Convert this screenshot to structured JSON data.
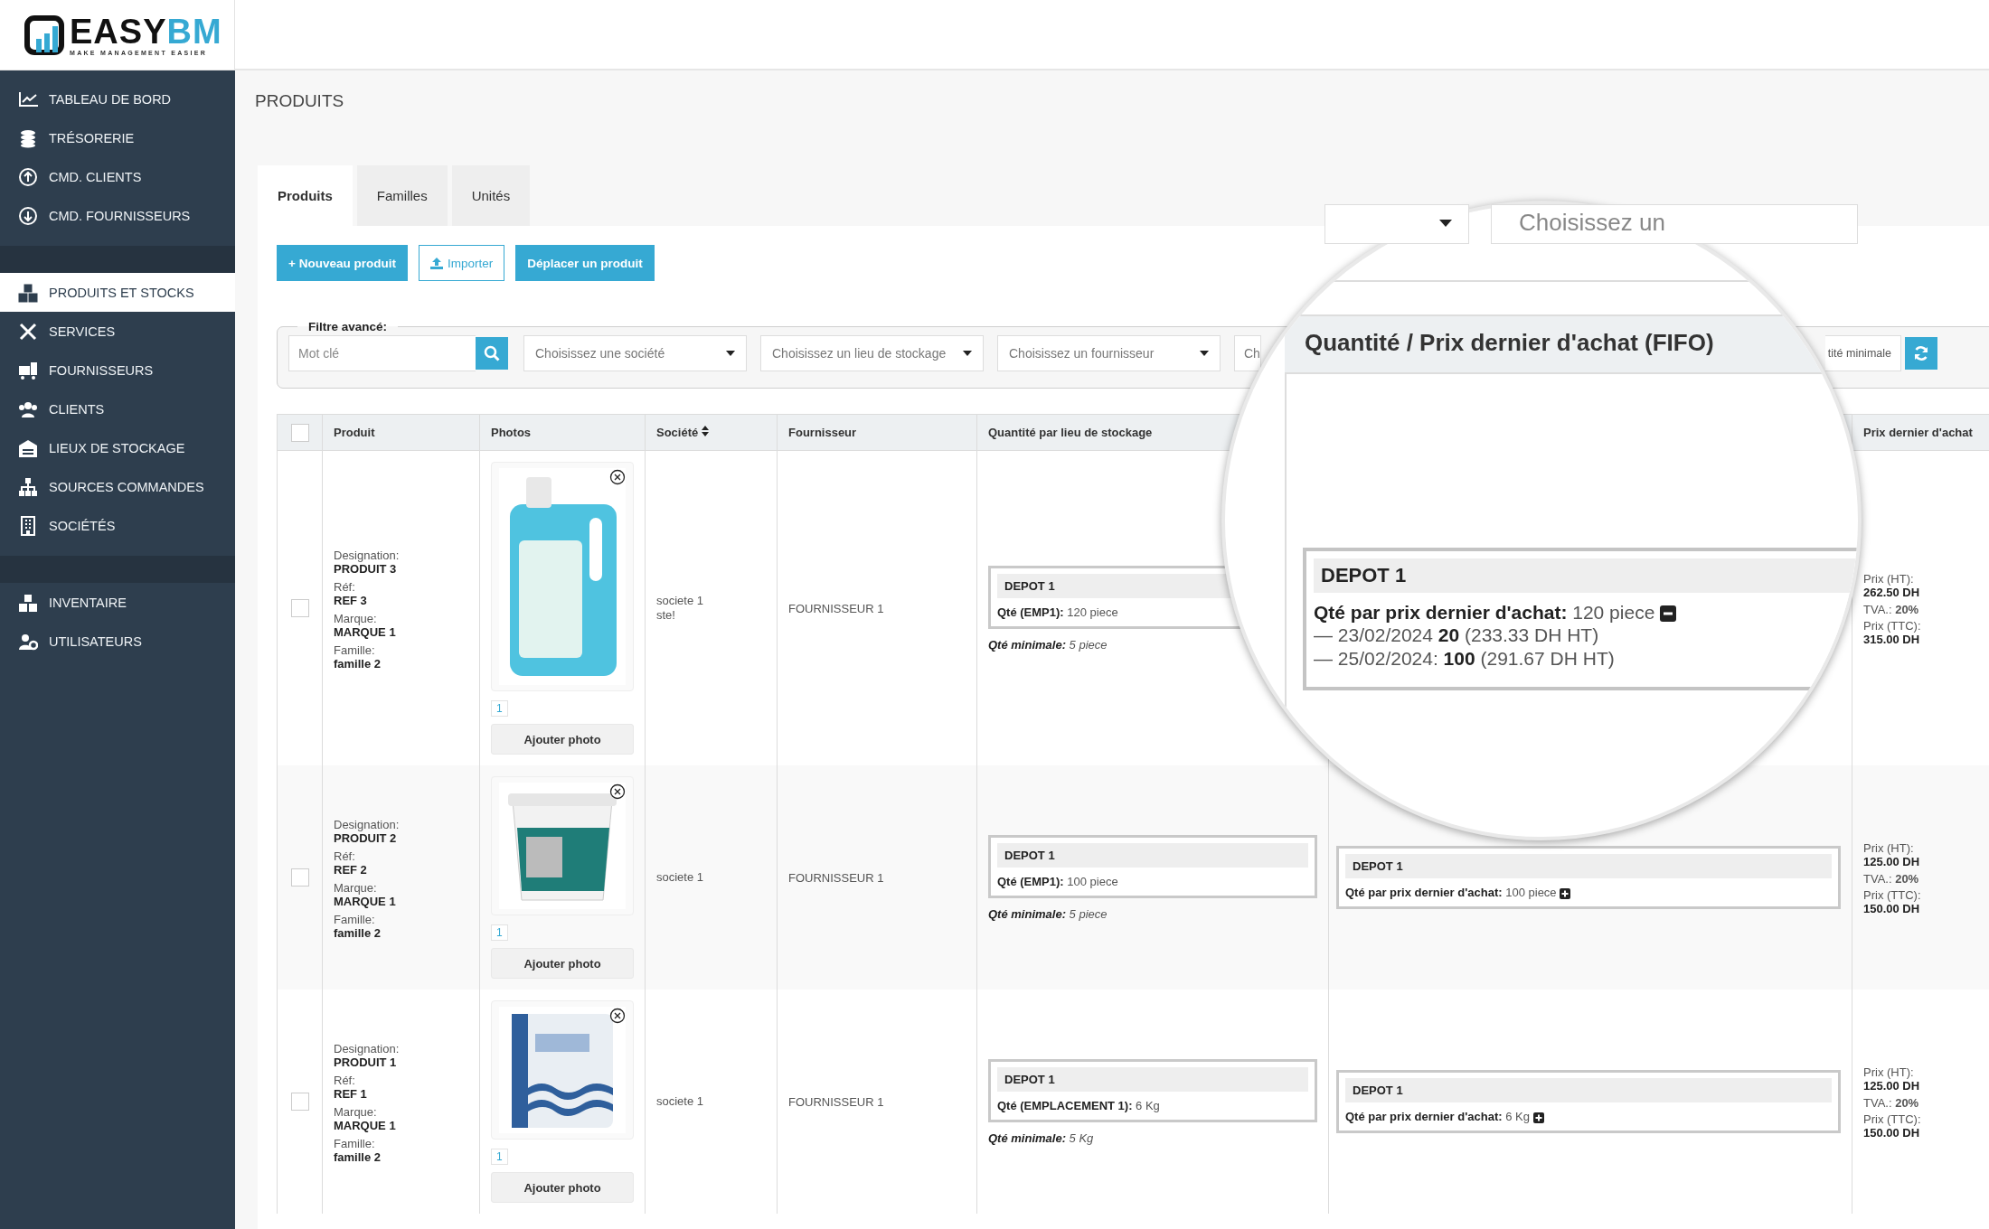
{
  "logo": {
    "word_1": "EASY",
    "word_2": "BM",
    "tagline": "MAKE MANAGEMENT EASIER"
  },
  "sidebar": {
    "groups": [
      [
        {
          "label": "TABLEAU DE BORD",
          "selected": false
        },
        {
          "label": "TRÉSORERIE",
          "selected": false
        },
        {
          "label": "CMD. CLIENTS",
          "selected": false
        },
        {
          "label": "CMD. FOURNISSEURS",
          "selected": false
        }
      ],
      [
        {
          "label": "PRODUITS ET STOCKS",
          "selected": true
        },
        {
          "label": "SERVICES",
          "selected": false
        },
        {
          "label": "FOURNISSEURS",
          "selected": false
        },
        {
          "label": "CLIENTS",
          "selected": false
        },
        {
          "label": "LIEUX DE STOCKAGE",
          "selected": false
        },
        {
          "label": "SOURCES COMMANDES",
          "selected": false
        },
        {
          "label": "SOCIÉTÉS",
          "selected": false
        }
      ],
      [
        {
          "label": "INVENTAIRE",
          "selected": false
        },
        {
          "label": "UTILISATEURS",
          "selected": false
        }
      ]
    ]
  },
  "page_title": "PRODUITS",
  "tabs": [
    {
      "label": "Produits",
      "selected": true
    },
    {
      "label": "Familles",
      "selected": false
    },
    {
      "label": "Unités",
      "selected": false
    }
  ],
  "actions": [
    {
      "label": "+ Nouveau produit",
      "kind": "primary"
    },
    {
      "label": "Importer",
      "kind": "outline"
    },
    {
      "label": "Déplacer un produit",
      "kind": "primary"
    }
  ],
  "filter": {
    "legend": "Filtre avancé:",
    "keyword_placeholder": "Mot clé",
    "selects": [
      "Choisissez une société",
      "Choisissez un lieu de stockage",
      "Choisissez un fournisseur",
      "Ch"
    ],
    "min_button": "tité minimale"
  },
  "table": {
    "select_all_checked": false,
    "columns": [
      {
        "label": "Produit",
        "sortable": false
      },
      {
        "label": "Photos",
        "sortable": false
      },
      {
        "label": "Société",
        "sortable": true
      },
      {
        "label": "Fournisseur",
        "sortable": false
      },
      {
        "label": "Quantité par lieu de stockage",
        "sortable": false
      },
      {
        "label": "Prix dernier d'achat",
        "sortable": false
      }
    ],
    "rows": [
      {
        "checked": false,
        "designation_label": "Designation:",
        "designation": "PRODUIT 3",
        "ref_label": "Réf:",
        "ref": "REF 3",
        "brand_label": "Marque:",
        "brand": "MARQUE 1",
        "family_label": "Famille:",
        "family": "famille 2",
        "photo_count": "1",
        "add_photo": "Ajouter photo",
        "company": [
          "societe 1",
          "ste!"
        ],
        "supplier": "FOURNISSEUR 1",
        "stock": {
          "depot": "DEPOT 1",
          "qty_label": "Qté (EMP1):",
          "qty": "120 piece",
          "min_label": "Qté minimale:",
          "min": "5 piece"
        },
        "price": {
          "ht_label": "Prix (HT):",
          "ht": "262.50 DH",
          "tva_label": "TVA.:",
          "tva": "20%",
          "ttc_label": "Prix (TTC):",
          "ttc": "315.00 DH"
        }
      },
      {
        "checked": false,
        "designation_label": "Designation:",
        "designation": "PRODUIT 2",
        "ref_label": "Réf:",
        "ref": "REF 2",
        "brand_label": "Marque:",
        "brand": "MARQUE 1",
        "family_label": "Famille:",
        "family": "famille 2",
        "photo_count": "1",
        "add_photo": "Ajouter photo",
        "company": [
          "societe 1"
        ],
        "supplier": "FOURNISSEUR 1",
        "stock": {
          "depot": "DEPOT 1",
          "qty_label": "Qté (EMP1):",
          "qty": "100 piece",
          "min_label": "Qté minimale:",
          "min": "5 piece"
        },
        "fifo": {
          "depot": "DEPOT 1",
          "qty_label": "Qté par prix dernier d'achat:",
          "qty": "100 piece",
          "expanded": false
        },
        "price": {
          "ht_label": "Prix (HT):",
          "ht": "125.00 DH",
          "tva_label": "TVA.:",
          "tva": "20%",
          "ttc_label": "Prix (TTC):",
          "ttc": "150.00 DH"
        }
      },
      {
        "checked": false,
        "designation_label": "Designation:",
        "designation": "PRODUIT 1",
        "ref_label": "Réf:",
        "ref": "REF 1",
        "brand_label": "Marque:",
        "brand": "MARQUE 1",
        "family_label": "Famille:",
        "family": "famille 2",
        "photo_count": "1",
        "add_photo": "Ajouter photo",
        "company": [
          "societe 1"
        ],
        "supplier": "FOURNISSEUR 1",
        "stock": {
          "depot": "DEPOT 1",
          "qty_label": "Qté (EMPLACEMENT 1):",
          "qty": "6 Kg",
          "min_label": "Qté minimale:",
          "min": "5 Kg"
        },
        "fifo": {
          "depot": "DEPOT 1",
          "qty_label": "Qté par prix dernier d'achat:",
          "qty": "6 Kg",
          "expanded": false
        },
        "price": {
          "ht_label": "Prix (HT):",
          "ht": "125.00 DH",
          "tva_label": "TVA.:",
          "tva": "20%",
          "ttc_label": "Prix (TTC):",
          "ttc": "150.00 DH"
        }
      }
    ]
  },
  "magnifier": {
    "select_placeholder": "Choisissez un",
    "column_header": "Quantité / Prix dernier d'achat (FIFO)",
    "depot": "DEPOT 1",
    "qty_label": "Qté par prix dernier d'achat:",
    "qty": "120 piece",
    "expanded": true,
    "entries": [
      "— 23/02/2024 **20** (233.33 DH HT)",
      "— 25/02/2024: **100** (291.67 DH HT)"
    ]
  }
}
